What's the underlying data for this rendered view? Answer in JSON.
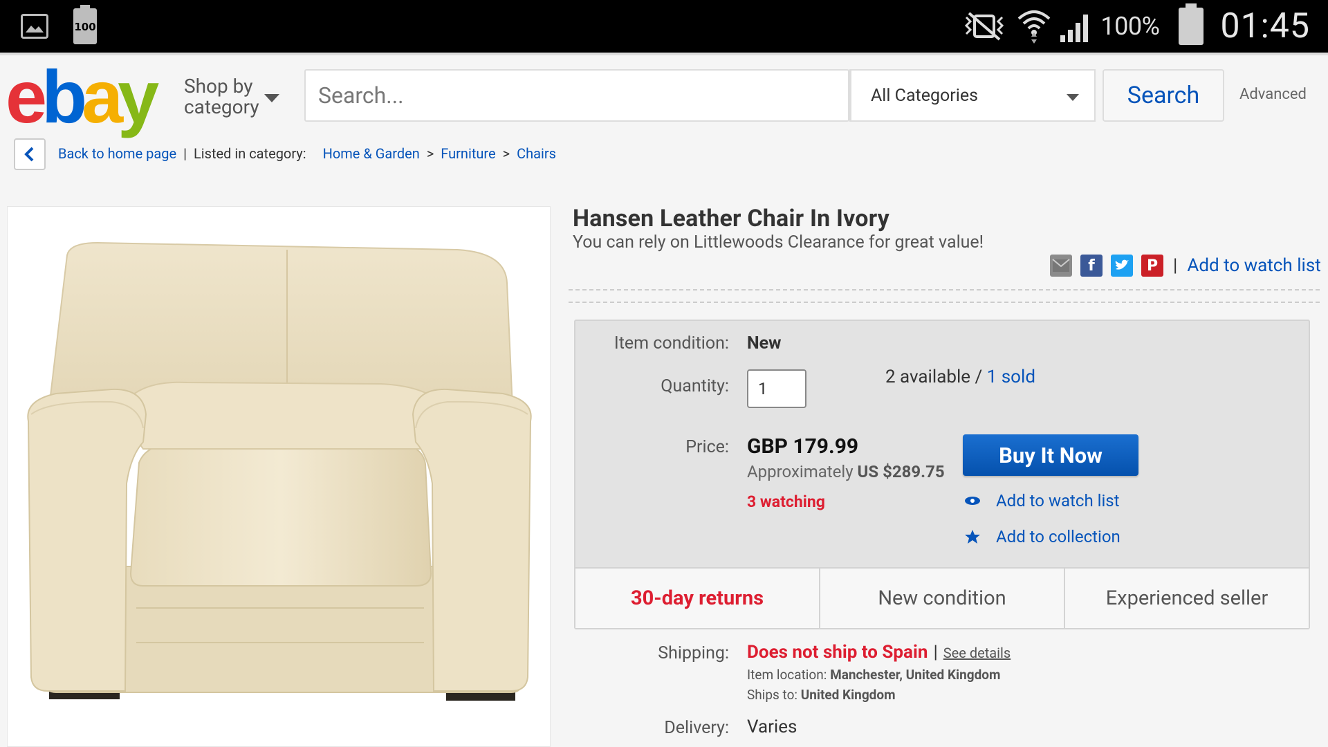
{
  "status_bar": {
    "battery_small": "100",
    "battery_pct": "100%",
    "time": "01:45"
  },
  "header": {
    "logo": {
      "e": "e",
      "b": "b",
      "a": "a",
      "y": "y"
    },
    "shop_by_line1": "Shop by",
    "shop_by_line2": "category",
    "search_placeholder": "Search...",
    "category_selected": "All Categories",
    "search_button": "Search",
    "advanced_link": "Advanced"
  },
  "breadcrumb": {
    "back": "Back to home page",
    "listed_in": "Listed in category:",
    "path": [
      "Home & Garden",
      "Furniture",
      "Chairs"
    ]
  },
  "listing": {
    "title": "Hansen Leather Chair In Ivory",
    "subtitle": "You can rely on Littlewoods Clearance for great value!",
    "share_icons": [
      "email-icon",
      "facebook-icon",
      "twitter-icon",
      "pinterest-icon"
    ],
    "add_to_watch_top": "Add to watch list"
  },
  "buybox": {
    "condition_label": "Item condition:",
    "condition_value": "New",
    "quantity_label": "Quantity:",
    "quantity_value": "1",
    "available_text": "2 available / ",
    "sold_text": "1 sold",
    "price_label": "Price:",
    "price_value": "GBP 179.99",
    "approx_prefix": "Approximately",
    "approx_value": "US $289.75",
    "watching": "3 watching",
    "buy_now": "Buy It Now",
    "add_watch": "Add to watch list",
    "add_collection": "Add to collection",
    "promos": [
      "30-day returns",
      "New condition",
      "Experienced seller"
    ]
  },
  "shipping": {
    "label": "Shipping:",
    "value": "Does not ship to Spain",
    "see_details": "See details",
    "item_location_label": "Item location:",
    "item_location": "Manchester, United Kingdom",
    "ships_to_label": "Ships to:",
    "ships_to": "United Kingdom",
    "delivery_label": "Delivery:",
    "delivery_value": "Varies"
  },
  "colors": {
    "ebay_red": "#e53238",
    "ebay_blue": "#0064d2",
    "ebay_yellow": "#f5af02",
    "ebay_green": "#86b817",
    "link_blue": "#0654ba",
    "alert_red": "#dd1e31"
  }
}
